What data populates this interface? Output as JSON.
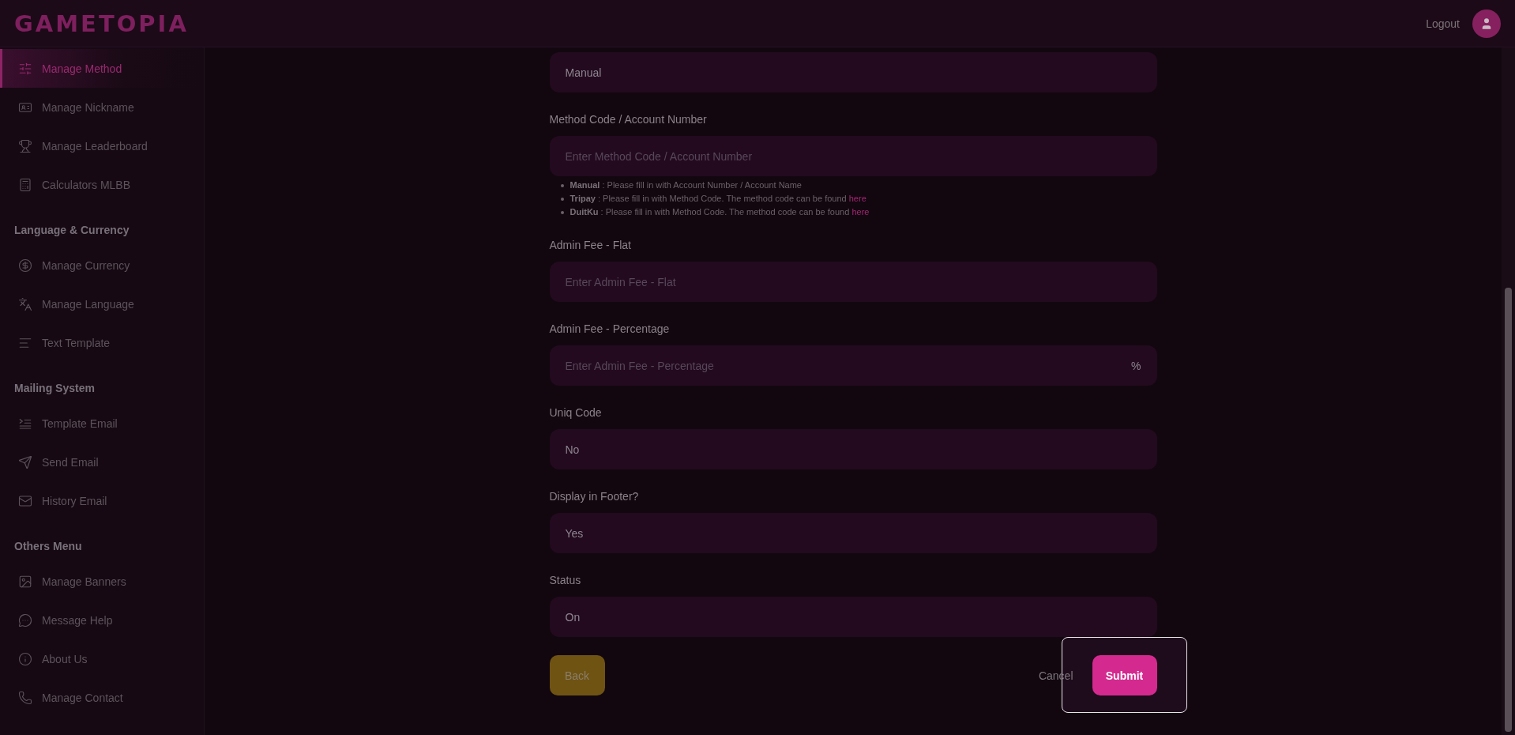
{
  "brand": "GAMETOPIA",
  "header": {
    "logout": "Logout"
  },
  "sidebar": {
    "items": [
      {
        "kind": "item",
        "label": "Manage Method",
        "selected": true
      },
      {
        "kind": "item",
        "label": "Manage Nickname",
        "selected": false
      },
      {
        "kind": "item",
        "label": "Manage Leaderboard",
        "selected": false
      },
      {
        "kind": "item",
        "label": "Calculators MLBB",
        "selected": false
      },
      {
        "kind": "heading",
        "label": "Language & Currency"
      },
      {
        "kind": "item",
        "label": "Manage Currency",
        "selected": false
      },
      {
        "kind": "item",
        "label": "Manage Language",
        "selected": false
      },
      {
        "kind": "item",
        "label": "Text Template",
        "selected": false
      },
      {
        "kind": "heading",
        "label": "Mailing System"
      },
      {
        "kind": "item",
        "label": "Template Email",
        "selected": false
      },
      {
        "kind": "item",
        "label": "Send Email",
        "selected": false
      },
      {
        "kind": "item",
        "label": "History Email",
        "selected": false
      },
      {
        "kind": "heading",
        "label": "Others Menu"
      },
      {
        "kind": "item",
        "label": "Manage Banners",
        "selected": false
      },
      {
        "kind": "item",
        "label": "Message Help",
        "selected": false
      },
      {
        "kind": "item",
        "label": "About Us",
        "selected": false
      },
      {
        "kind": "item",
        "label": "Manage Contact",
        "selected": false
      }
    ]
  },
  "form": {
    "fields": [
      {
        "kind": "select",
        "value": "Manual"
      },
      {
        "kind": "input",
        "label": "Method Code / Account Number",
        "placeholder": "Enter Method Code / Account Number",
        "help": [
          {
            "text": "**Manual** : Please fill in with Account Number / Account Name"
          },
          {
            "text": "**Tripay** : Please fill in with Method Code. The method code can be found",
            "link": "here"
          },
          {
            "text": "**DuitKu** : Please fill in with Method Code. The method code can be found",
            "link": "here"
          }
        ]
      },
      {
        "kind": "input",
        "label": "Admin Fee - Flat",
        "placeholder": "Enter Admin Fee - Flat"
      },
      {
        "kind": "input",
        "label": "Admin Fee - Percentage",
        "placeholder": "Enter Admin Fee - Percentage",
        "suffix": "%"
      },
      {
        "kind": "select",
        "label": "Uniq Code",
        "value": "No"
      },
      {
        "kind": "select",
        "label": "Display in Footer?",
        "value": "Yes"
      },
      {
        "kind": "select",
        "label": "Status",
        "value": "On"
      }
    ],
    "back": "Back",
    "cancel": "Cancel",
    "submit": {
      "label": "Submit",
      "highlighted": true
    }
  }
}
